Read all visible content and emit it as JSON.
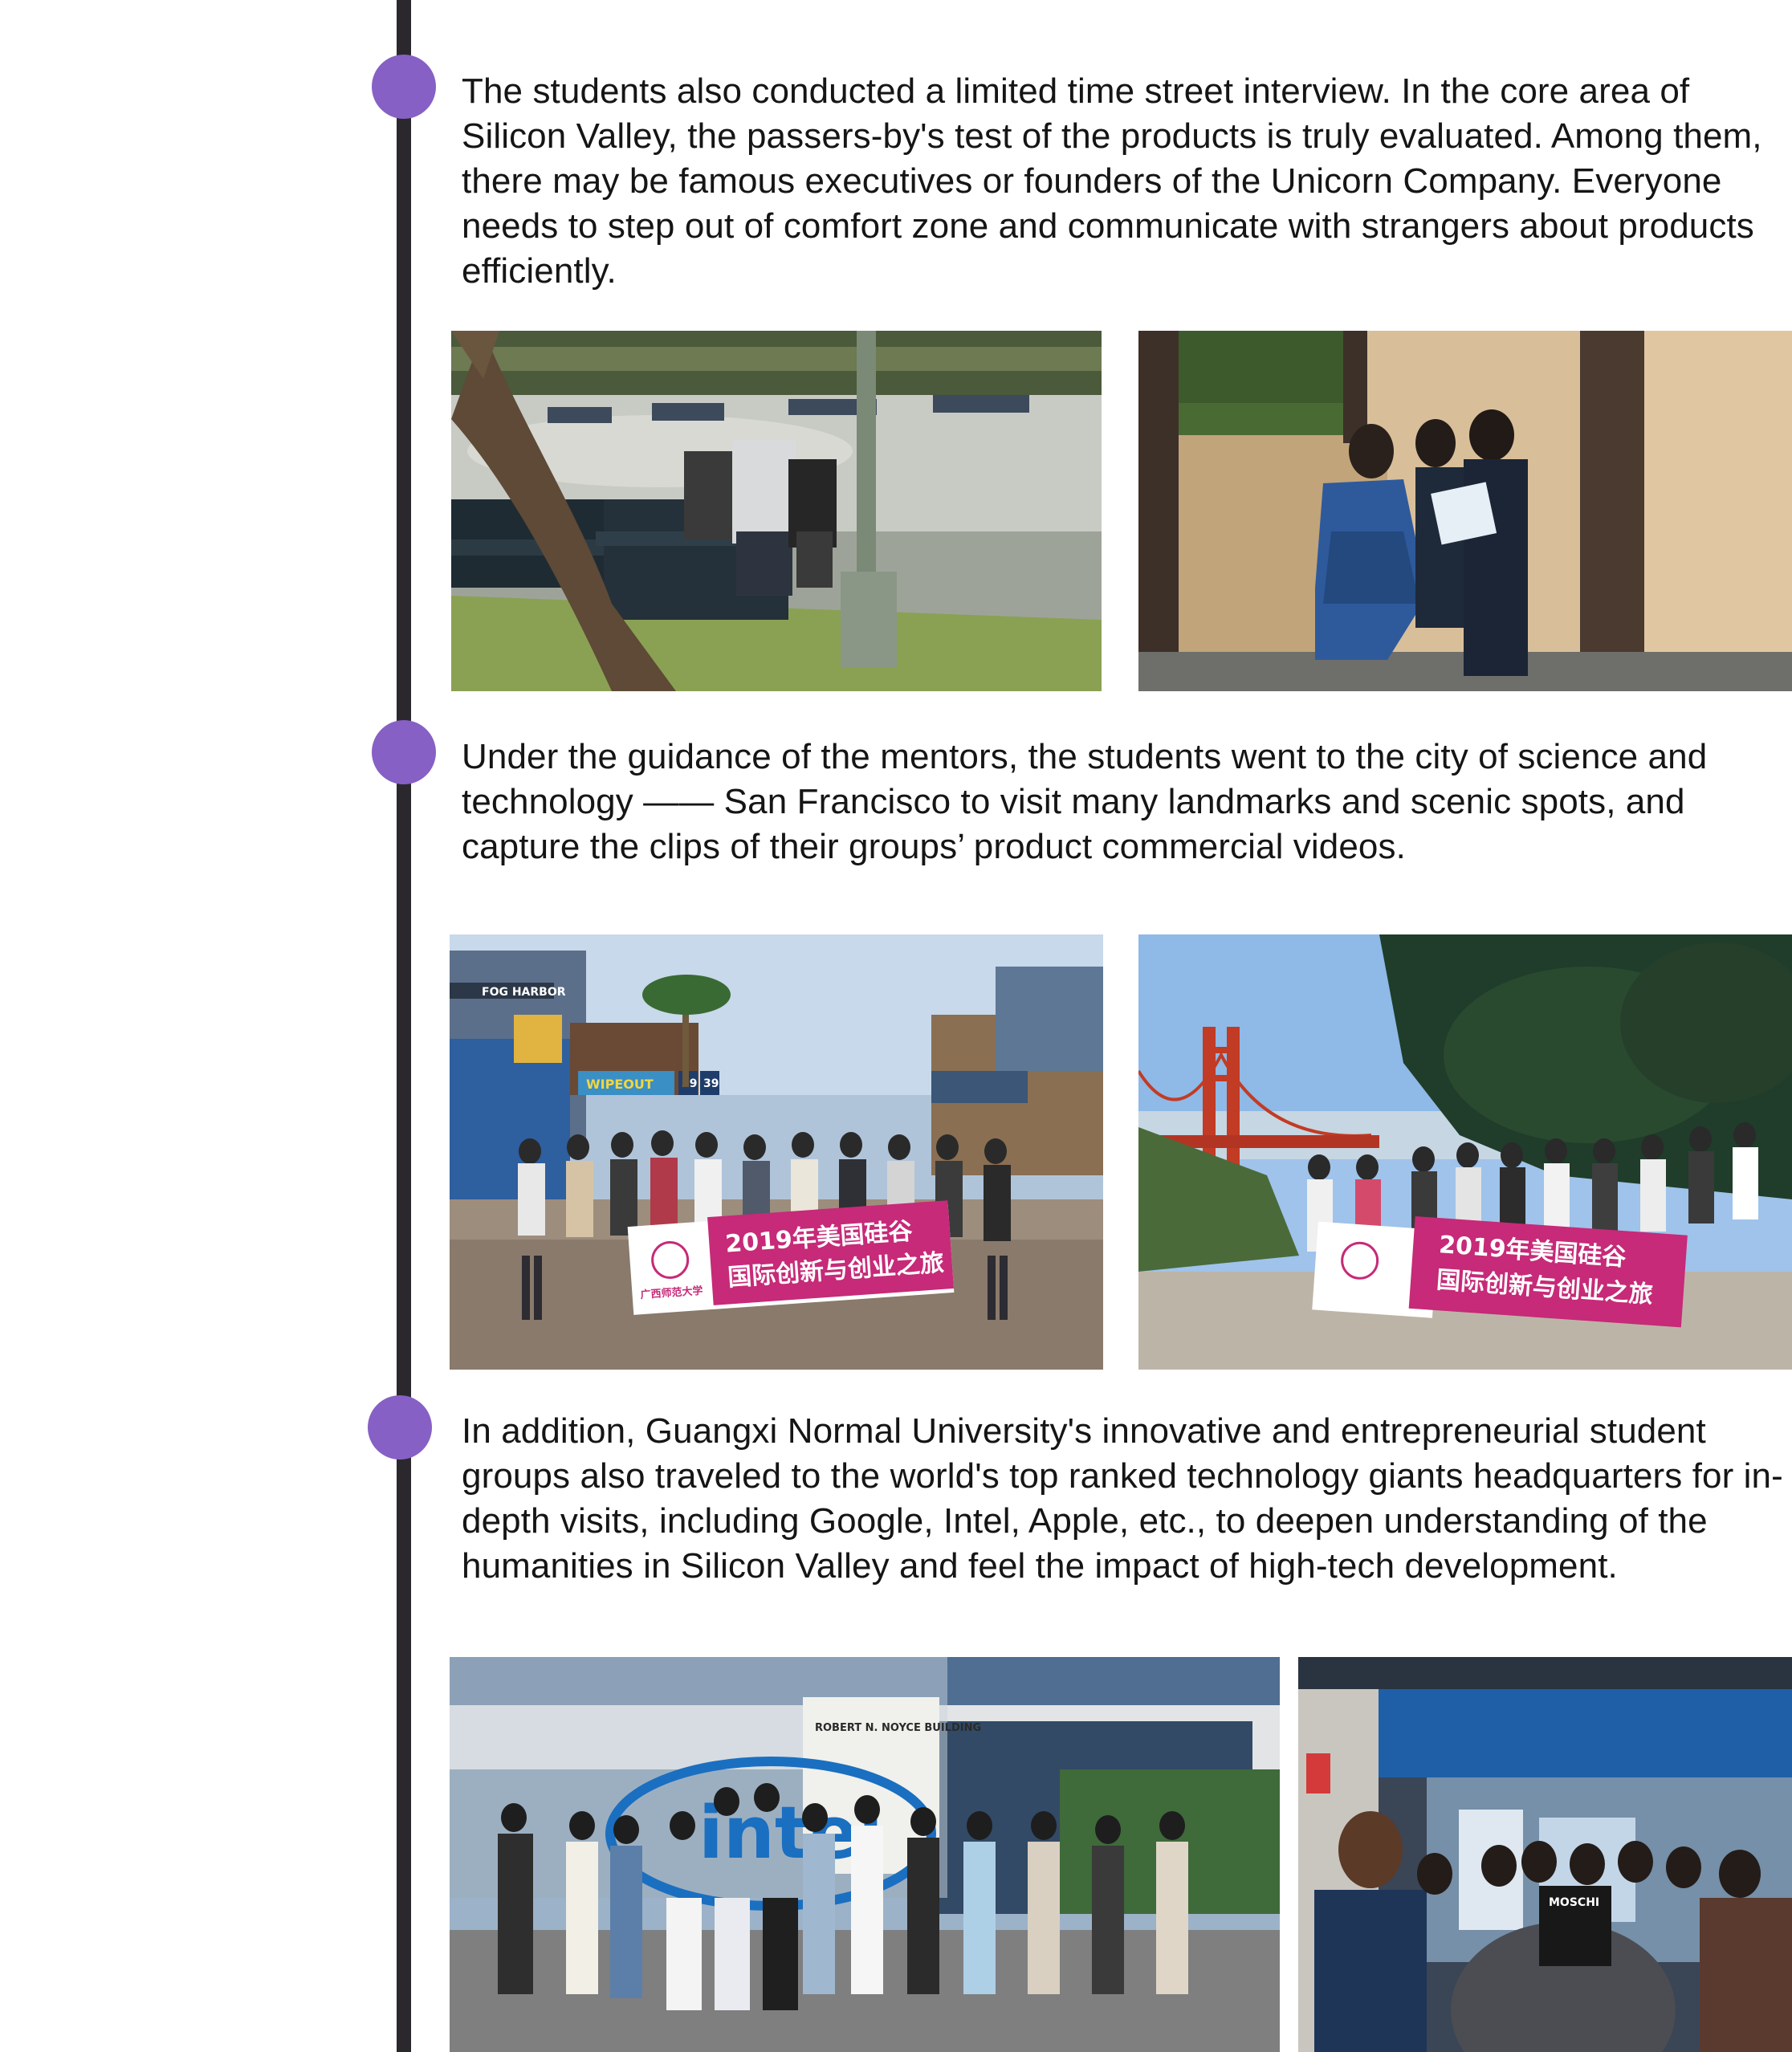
{
  "timeline": {
    "entries": [
      {
        "text": "The students also conducted a limited time street interview. In the core area of Silicon Valley, the passers-by's test of the products is truly evaluated. Among them, there may be famous executives or founders of the Unicorn Company. Everyone needs to step out of comfort zone and communicate with strangers about products efficiently."
      },
      {
        "text": "Under the guidance of the mentors, the students went to the city of science and technology —— San Francisco to visit many landmarks and scenic spots, and capture the clips of their groups’ product commercial videos."
      },
      {
        "text": "In addition, Guangxi Normal University's innovative and entrepreneurial student groups also traveled to the world's top ranked technology giants headquarters for in-depth visits, including Google, Intel, Apple, etc., to deepen understanding of the humanities in Silicon Valley and feel the impact of high-tech development."
      }
    ]
  },
  "photos": {
    "pier_sign": "FOG HARBOR",
    "pier_numbers": [
      "39",
      "39"
    ],
    "wipeout_sign": "WIPEOUT",
    "banner_line1": "2019年美国硅谷",
    "banner_line2": "国际创新与创业之旅",
    "banner_logo": "广西师范大学",
    "building_sign": "ROBERT N. NOYCE BUILDING",
    "intel_logo": "intel",
    "shirt_text": "MOSCHI"
  },
  "colors": {
    "timeline_line": "#2b282d",
    "dot": "#8660c5",
    "banner": "#c62a78"
  }
}
